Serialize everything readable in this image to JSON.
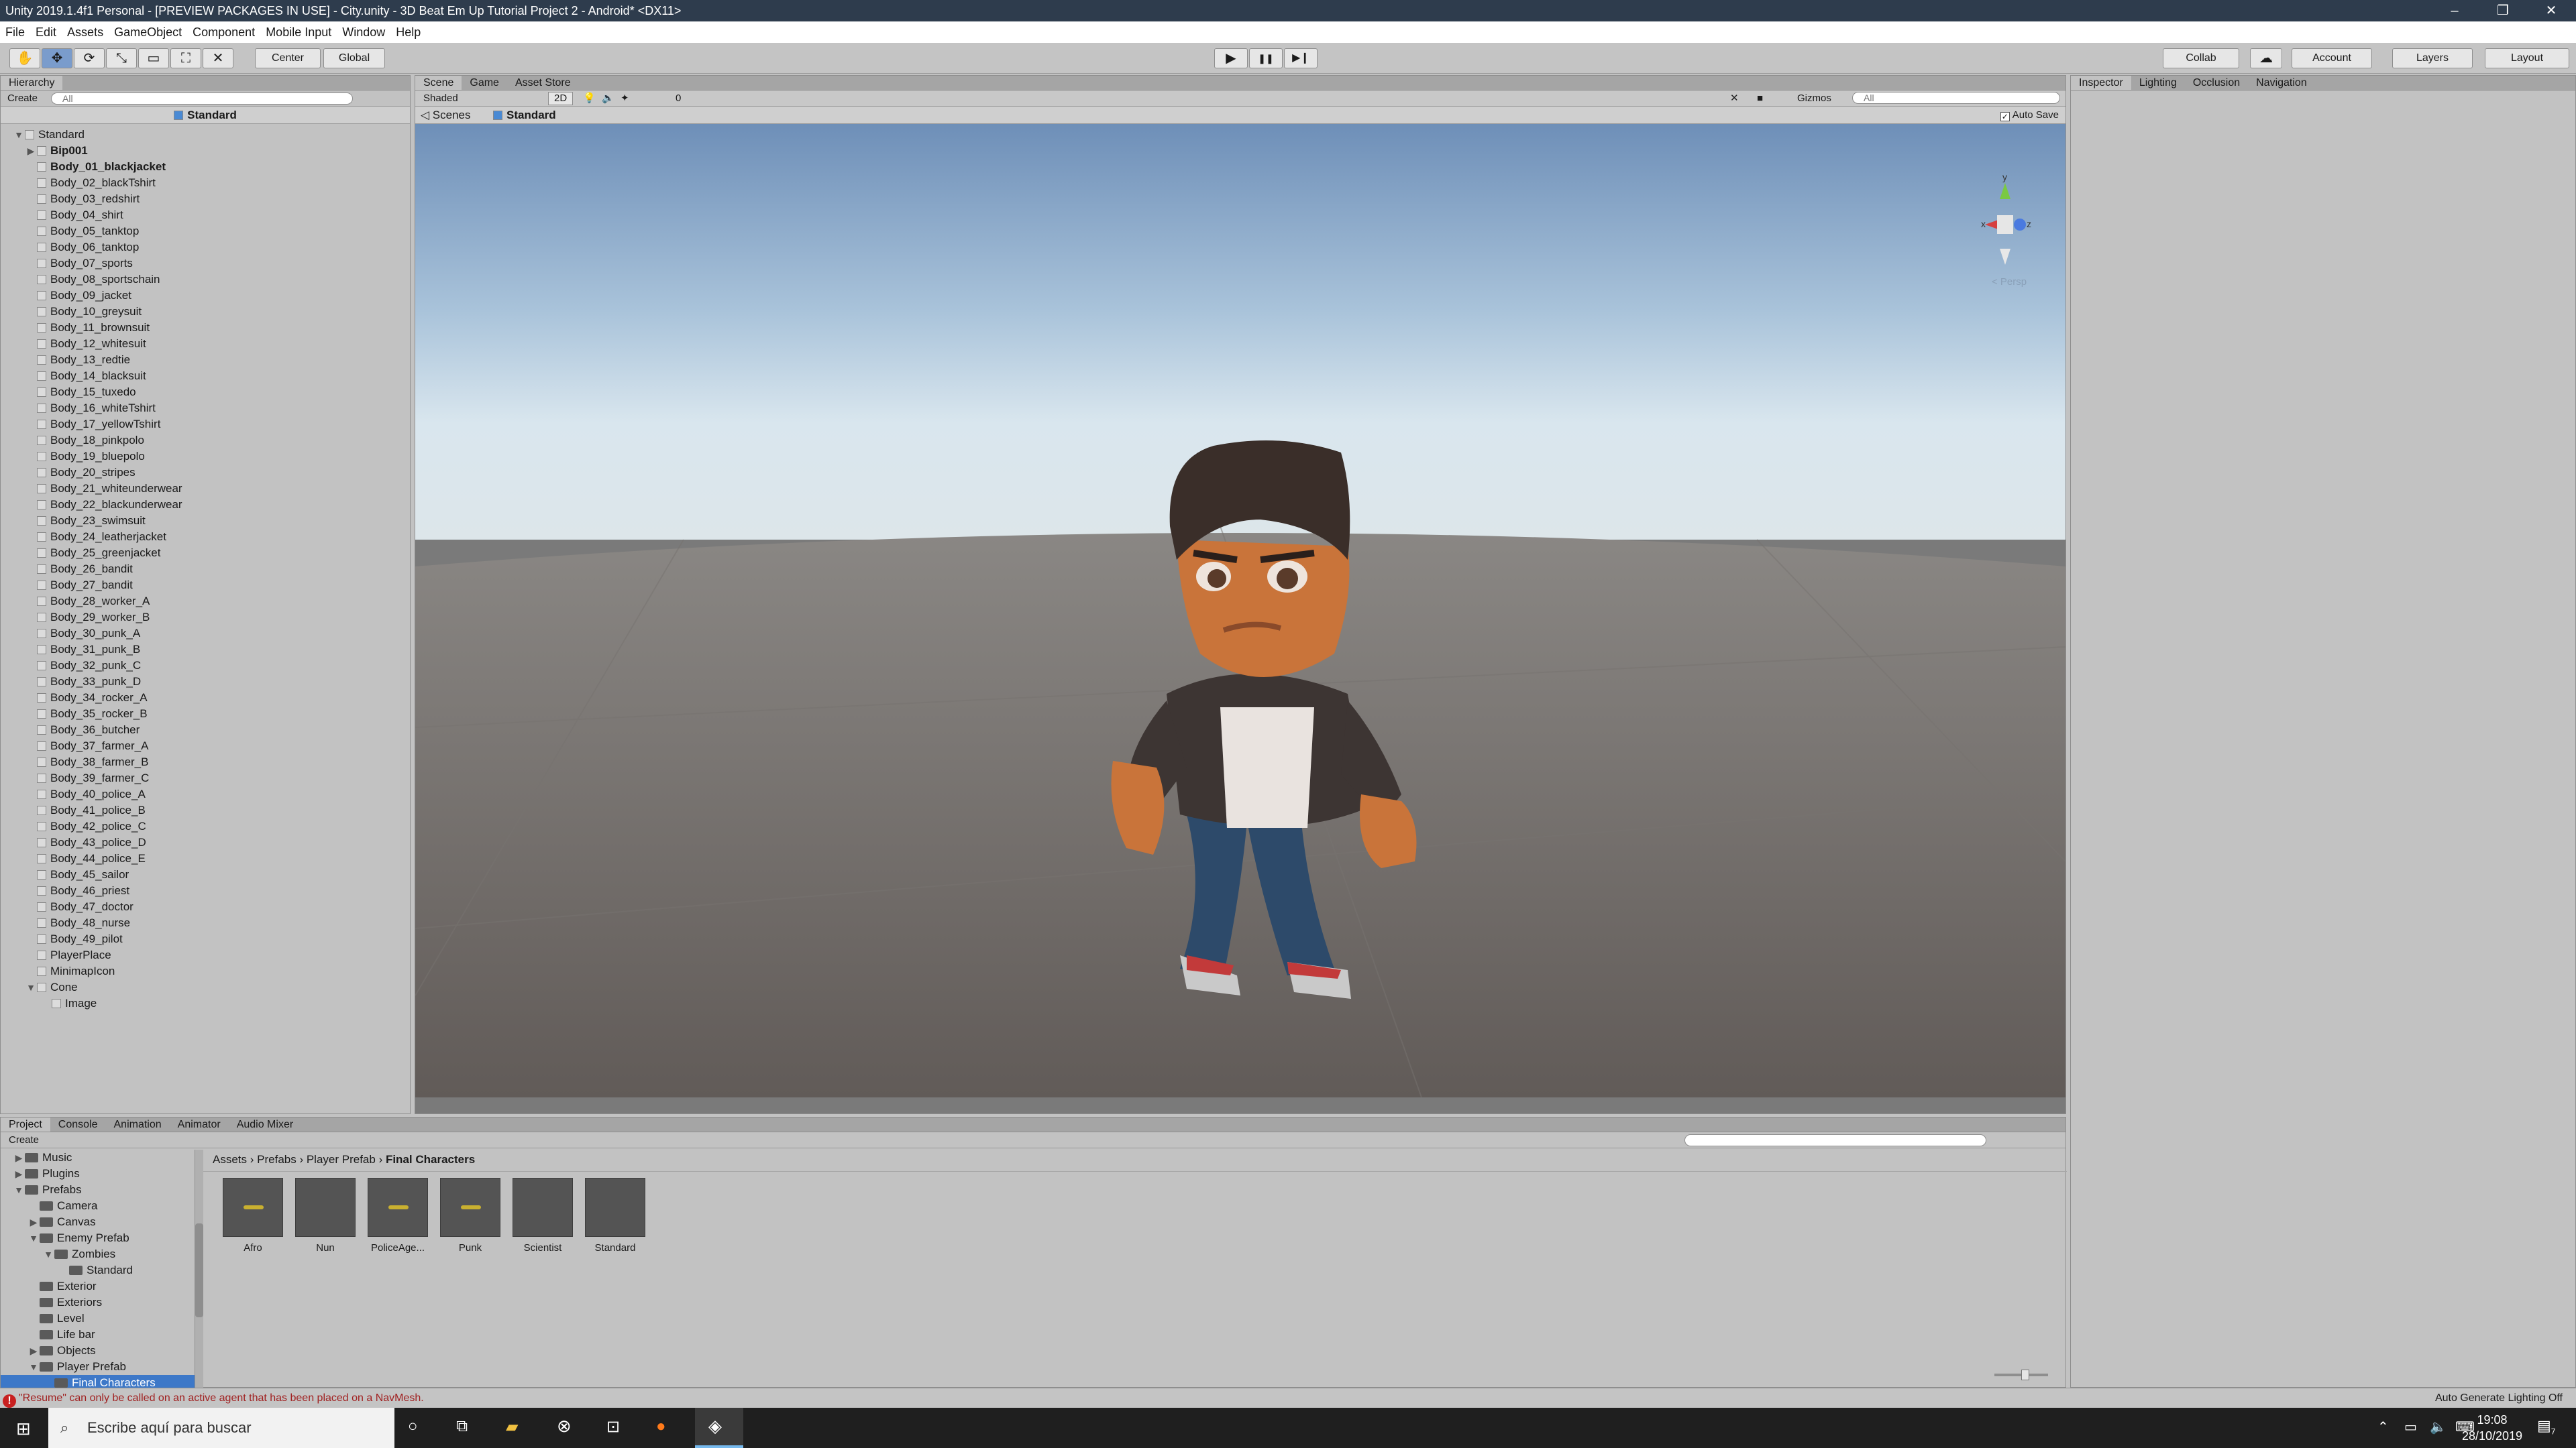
{
  "window": {
    "title": "Unity 2019.1.4f1 Personal - [PREVIEW PACKAGES IN USE] - City.unity - 3D Beat Em Up Tutorial Project 2 - Android* <DX11>",
    "minimize": "–",
    "restore": "❐",
    "close": "✕"
  },
  "menu": [
    "File",
    "Edit",
    "Assets",
    "GameObject",
    "Component",
    "Mobile Input",
    "Window",
    "Help"
  ],
  "toolbar": {
    "hand": "✋",
    "move": "✥",
    "rotate": "⟳",
    "scale": "⤡",
    "rect": "▭",
    "transform": "⛶",
    "custom": "✕",
    "pivot": "Center",
    "space": "Global",
    "play": "▶",
    "pause": "❚❚",
    "step": "▶❙",
    "collab": "Collab",
    "cloud": "☁",
    "account": "Account",
    "layers": "Layers",
    "layout": "Layout"
  },
  "hierarchy": {
    "tab": "Hierarchy",
    "create": "Create",
    "search_placeholder": "All",
    "scene": "Standard",
    "root": "Standard",
    "items": [
      "Bip001",
      "Body_01_blackjacket",
      "Body_02_blackTshirt",
      "Body_03_redshirt",
      "Body_04_shirt",
      "Body_05_tanktop",
      "Body_06_tanktop",
      "Body_07_sports",
      "Body_08_sportschain",
      "Body_09_jacket",
      "Body_10_greysuit",
      "Body_11_brownsuit",
      "Body_12_whitesuit",
      "Body_13_redtie",
      "Body_14_blacksuit",
      "Body_15_tuxedo",
      "Body_16_whiteTshirt",
      "Body_17_yellowTshirt",
      "Body_18_pinkpolo",
      "Body_19_bluepolo",
      "Body_20_stripes",
      "Body_21_whiteunderwear",
      "Body_22_blackunderwear",
      "Body_23_swimsuit",
      "Body_24_leatherjacket",
      "Body_25_greenjacket",
      "Body_26_bandit",
      "Body_27_bandit",
      "Body_28_worker_A",
      "Body_29_worker_B",
      "Body_30_punk_A",
      "Body_31_punk_B",
      "Body_32_punk_C",
      "Body_33_punk_D",
      "Body_34_rocker_A",
      "Body_35_rocker_B",
      "Body_36_butcher",
      "Body_37_farmer_A",
      "Body_38_farmer_B",
      "Body_39_farmer_C",
      "Body_40_police_A",
      "Body_41_police_B",
      "Body_42_police_C",
      "Body_43_police_D",
      "Body_44_police_E",
      "Body_45_sailor",
      "Body_46_priest",
      "Body_47_doctor",
      "Body_48_nurse",
      "Body_49_pilot",
      "PlayerPlace",
      "MinimapIcon",
      "Cone",
      "Image"
    ]
  },
  "scene": {
    "tabs": [
      "Scene",
      "Game",
      "Asset Store"
    ],
    "shading": "Shaded",
    "mode2d": "2D",
    "gizmos": "Gizmos",
    "search_placeholder": "All",
    "breadcrumb_root": "Scenes",
    "breadcrumb_current": "Standard",
    "auto_save": "Auto Save",
    "persp": "< Persp",
    "axis_x": "x",
    "axis_y": "y",
    "axis_z": "z",
    "hidden_count": "0"
  },
  "inspector": {
    "tabs": [
      "Inspector",
      "Lighting",
      "Occlusion",
      "Navigation"
    ]
  },
  "project": {
    "tabs": [
      "Project",
      "Console",
      "Animation",
      "Animator",
      "Audio Mixer"
    ],
    "create": "Create",
    "tree": [
      {
        "label": "Music",
        "level": 1,
        "arrow": "▶"
      },
      {
        "label": "Plugins",
        "level": 1,
        "arrow": "▶"
      },
      {
        "label": "Prefabs",
        "level": 1,
        "arrow": "▼"
      },
      {
        "label": "Camera",
        "level": 2,
        "arrow": ""
      },
      {
        "label": "Canvas",
        "level": 2,
        "arrow": "▶"
      },
      {
        "label": "Enemy Prefab",
        "level": 2,
        "arrow": "▼"
      },
      {
        "label": "Zombies",
        "level": 3,
        "arrow": "▼"
      },
      {
        "label": "Standard",
        "level": 4,
        "arrow": ""
      },
      {
        "label": "Exterior",
        "level": 2,
        "arrow": ""
      },
      {
        "label": "Exteriors",
        "level": 2,
        "arrow": ""
      },
      {
        "label": "Level",
        "level": 2,
        "arrow": ""
      },
      {
        "label": "Life bar",
        "level": 2,
        "arrow": ""
      },
      {
        "label": "Objects",
        "level": 2,
        "arrow": "▶"
      },
      {
        "label": "Player Prefab",
        "level": 2,
        "arrow": "▼"
      },
      {
        "label": "Final Characters",
        "level": 3,
        "arrow": ""
      }
    ],
    "breadcrumb": [
      "Assets",
      "Prefabs",
      "Player Prefab",
      "Final Characters"
    ],
    "assets": [
      "Afro",
      "Nun",
      "PoliceAge...",
      "Punk",
      "Scientist",
      "Standard"
    ]
  },
  "status": {
    "message": "\"Resume\" can only be called on an active agent that has been placed on a NavMesh.",
    "right": "Auto Generate Lighting Off"
  },
  "taskbar": {
    "search": "Escribe aquí para buscar",
    "time": "19:08",
    "date": "28/10/2019",
    "notif": "7"
  }
}
